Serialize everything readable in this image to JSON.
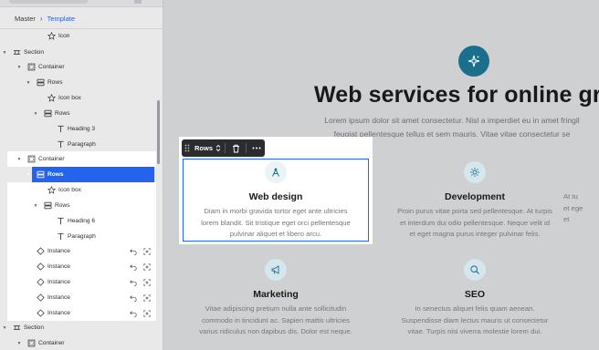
{
  "breadcrumb": {
    "root": "Master",
    "current": "Template"
  },
  "tree": [
    {
      "label": "Icon",
      "icon": "star-icon",
      "caret": ""
    },
    {
      "label": "Section",
      "icon": "section-icon",
      "caret": "▾"
    },
    {
      "label": "Container",
      "icon": "container-icon",
      "caret": "▾"
    },
    {
      "label": "Rows",
      "icon": "rows-icon",
      "caret": "▾"
    },
    {
      "label": "Icon box",
      "icon": "star-icon",
      "caret": ""
    },
    {
      "label": "Rows",
      "icon": "rows-icon",
      "caret": "▾"
    },
    {
      "label": "Heading 3",
      "icon": "text-icon",
      "caret": ""
    },
    {
      "label": "Paragraph",
      "icon": "text-icon",
      "caret": ""
    },
    {
      "label": "Container",
      "icon": "container-icon",
      "caret": "▾"
    },
    {
      "label": "Rows",
      "icon": "rows-icon",
      "caret": "▾"
    },
    {
      "label": "Icon box",
      "icon": "star-icon",
      "caret": ""
    },
    {
      "label": "Rows",
      "icon": "rows-icon",
      "caret": "▾"
    },
    {
      "label": "Heading 6",
      "icon": "text-icon",
      "caret": ""
    },
    {
      "label": "Paragraph",
      "icon": "text-icon",
      "caret": ""
    },
    {
      "label": "Instance",
      "icon": "instance-icon",
      "caret": ""
    },
    {
      "label": "Instance",
      "icon": "instance-icon",
      "caret": ""
    },
    {
      "label": "Instance",
      "icon": "instance-icon",
      "caret": ""
    },
    {
      "label": "Instance",
      "icon": "instance-icon",
      "caret": ""
    },
    {
      "label": "Instance",
      "icon": "instance-icon",
      "caret": ""
    },
    {
      "label": "Section",
      "icon": "section-icon",
      "caret": "▾"
    },
    {
      "label": "Container",
      "icon": "container-icon",
      "caret": "▾"
    }
  ],
  "toolbar": {
    "label": "Rows"
  },
  "hero": {
    "title": "Web services for online grow",
    "subtitle_line1": "Lorem ipsum dolor sit amet consectetur. Nisl a imperdiet eu in amet fringil",
    "subtitle_line2": "feugiat pellentesque tellus et sem mauris. Vitae vitae consectetur se"
  },
  "cards": [
    {
      "title": "Web design",
      "icon": "compass-icon",
      "lines": [
        "Diam in morbi gravida tortor eget ante ultricies",
        "lorem blandit. Sit tristique eget orci pellentesque",
        "pulvinar aliquet et libero arcu."
      ]
    },
    {
      "title": "Development",
      "icon": "gear-icon",
      "lines": [
        "Proin purus vitae porta sed pellentesque. At turpis",
        "et interdum dui odio pellentesque. Neque velit id",
        "et eget magna purus integer pulvinar felis."
      ]
    },
    {
      "title": "Marketing",
      "icon": "megaphone-icon",
      "lines": [
        "Vitae adipiscing pretium nulla ante sollicitudin",
        "commodo in tincidunt ac. Sapien mattis ultricies",
        "varius ridiculus non dapibus dis. Dolor est neque."
      ]
    },
    {
      "title": "SEO",
      "icon": "search-icon",
      "lines": [
        "In senectus aliquet felis quam aenean.",
        "Suspendisse diam lectus mauris ut consectetur",
        "vitae. Turpis nisi viverra molestie lorem dui."
      ]
    },
    {
      "title": "",
      "icon": "partial-icon",
      "lines": [
        "At tu",
        "et ege",
        "et"
      ]
    }
  ],
  "colors": {
    "accent": "#2463eb",
    "brand": "#1a6f8c",
    "icon_bg": "#d5e6ec"
  }
}
